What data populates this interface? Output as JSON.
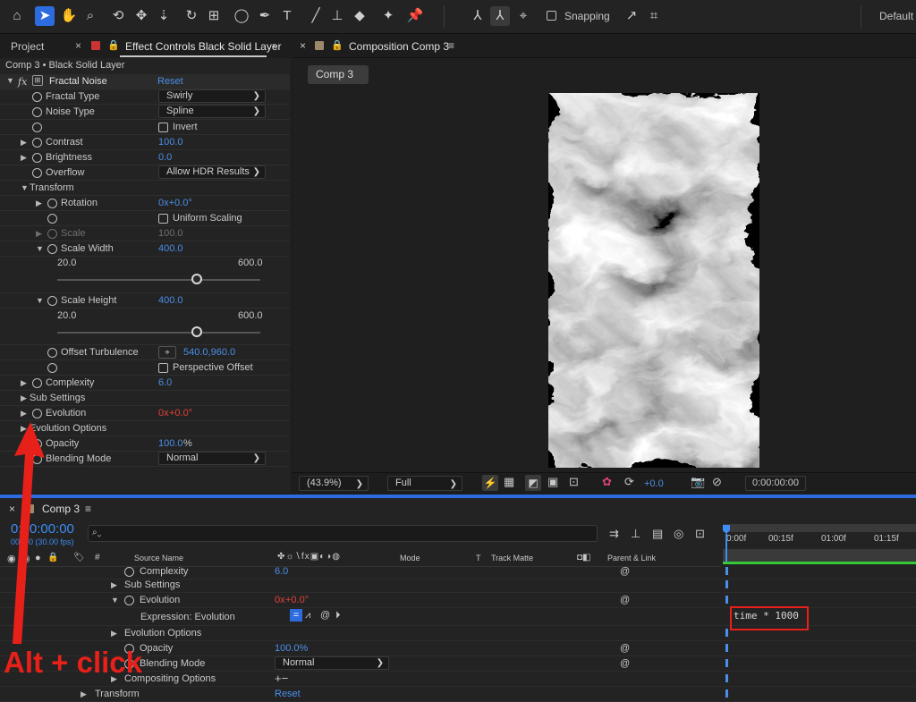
{
  "toolbar": {
    "snapping_label": "Snapping",
    "workspace_label": "Default"
  },
  "left_panel": {
    "tab_project": "Project",
    "tab_effect_controls": "Effect Controls Black Solid Layer",
    "layer_title": "Comp 3 • Black Solid Layer",
    "effect_name": "Fractal Noise",
    "reset_label": "Reset",
    "props": {
      "fractal_type_label": "Fractal Type",
      "fractal_type_value": "Swirly",
      "noise_type_label": "Noise Type",
      "noise_type_value": "Spline",
      "invert_label": "Invert",
      "contrast_label": "Contrast",
      "contrast_value": "100.0",
      "brightness_label": "Brightness",
      "brightness_value": "0.0",
      "overflow_label": "Overflow",
      "overflow_value": "Allow HDR Results",
      "transform_label": "Transform",
      "rotation_label": "Rotation",
      "rotation_value": "0x+0.0°",
      "uniform_scaling_label": "Uniform Scaling",
      "scale_label": "Scale",
      "scale_value": "100.0",
      "scale_width_label": "Scale Width",
      "scale_width_value": "400.0",
      "scale_width_min": "20.0",
      "scale_width_max": "600.0",
      "scale_height_label": "Scale Height",
      "scale_height_value": "400.0",
      "scale_height_min": "20.0",
      "scale_height_max": "600.0",
      "offset_turbulence_label": "Offset Turbulence",
      "offset_turbulence_value": "540.0,960.0",
      "perspective_offset_label": "Perspective Offset",
      "complexity_label": "Complexity",
      "complexity_value": "6.0",
      "sub_settings_label": "Sub Settings",
      "evolution_label": "Evolution",
      "evolution_value_a": "0x",
      "evolution_value_b": "+0.0°",
      "evolution_options_label": "Evolution Options",
      "opacity_label": "Opacity",
      "opacity_value": "100.0",
      "opacity_unit": "%",
      "blending_mode_label": "Blending Mode",
      "blending_mode_value": "Normal"
    }
  },
  "comp_panel": {
    "tab_title": "Composition Comp 3",
    "comp_button": "Comp 3",
    "zoom": "(43.9%)",
    "resolution": "Full",
    "exposure": "+0.0",
    "timecode": "0:00:00:00"
  },
  "timeline": {
    "tab_title": "Comp 3",
    "current_time": "0:00:00:00",
    "fps": "00000 (30.00 fps)",
    "search_placeholder": "",
    "col_source_name": "Source Name",
    "col_mode": "Mode",
    "col_t": "T",
    "col_track_matte": "Track Matte",
    "col_parent_link": "Parent & Link",
    "ruler": [
      "0:00f",
      "00:15f",
      "01:00f",
      "01:15f"
    ],
    "rows": {
      "complexity_label": "Complexity",
      "complexity_value": "6.0",
      "sub_settings_label": "Sub Settings",
      "evolution_label": "Evolution",
      "evolution_value_a": "0x",
      "evolution_value_b": "+0.0°",
      "expression_label": "Expression: Evolution",
      "evolution_options_label": "Evolution Options",
      "opacity_label": "Opacity",
      "opacity_value": "100.0%",
      "blending_mode_label": "Blending Mode",
      "blending_mode_value": "Normal",
      "compositing_options_label": "Compositing Options",
      "compositing_options_value": "+−",
      "transform_label": "Transform",
      "transform_reset": "Reset"
    },
    "expression_text": "time * 1000"
  },
  "annotation": {
    "text": "Alt + click",
    "color": "#e8201a"
  }
}
